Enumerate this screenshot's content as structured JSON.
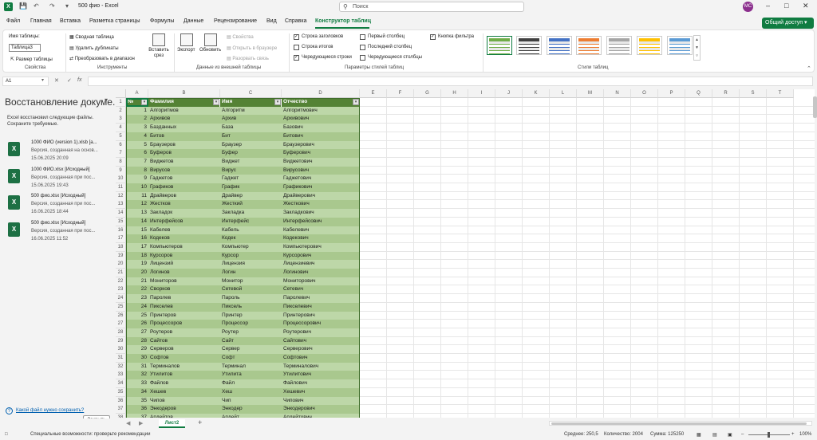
{
  "window": {
    "app_logo": "X",
    "title": "500 фио  -  Excel",
    "search_placeholder": "Поиск",
    "avatar": "MC"
  },
  "menu": {
    "items": [
      "Файл",
      "Главная",
      "Вставка",
      "Разметка страницы",
      "Формулы",
      "Данные",
      "Рецензирование",
      "Вид",
      "Справка",
      "Конструктор таблиц"
    ],
    "active": "Конструктор таблиц",
    "share": "Общий доступ"
  },
  "ribbon": {
    "table_name_label": "Имя таблицы:",
    "table_name_value": "Таблица3",
    "resize": "Размер таблицы",
    "group_props": "Свойства",
    "pivot": "Сводная таблица",
    "remove_dupes": "Удалить дубликаты",
    "convert": "Преобразовать в диапазон",
    "slicer": "Вставить срез",
    "group_tools": "Инструменты",
    "export": "Экспорт",
    "refresh": "Обновить",
    "properties": "Свойства",
    "open_browser": "Открыть в браузере",
    "unlink": "Разорвать связь",
    "group_external": "Данные из внешней таблицы",
    "opt_header": "Строка заголовков",
    "opt_total": "Строка итогов",
    "opt_banded_rows": "Чередующиеся строки",
    "opt_first_col": "Первый столбец",
    "opt_last_col": "Последний столбец",
    "opt_banded_cols": "Чередующиеся столбцы",
    "opt_filter": "Кнопка фильтра",
    "group_options": "Параметры стилей таблиц",
    "group_styles": "Стили таблиц",
    "style_colors": [
      "#70ad47",
      "#404040",
      "#4472c4",
      "#ed7d31",
      "#a5a5a5",
      "#ffc000",
      "#5b9bd5",
      "#8e3c8e"
    ]
  },
  "formula": {
    "cell": "A1",
    "fx": "fx",
    "value": ""
  },
  "recovery": {
    "title": "Восстановление докуме...",
    "desc": "Excel восстановил следующие файлы. Сохраните требуемые.",
    "files": [
      {
        "name": "1000 ФИО (version 1).xlsb  [а...",
        "version": "Версия, созданная на основ...",
        "date": "15.06.2025 20:09"
      },
      {
        "name": "1000 ФИО.xlsx  [Исходный]",
        "version": "Версия, созданная при пос...",
        "date": "15.06.2025 19:43"
      },
      {
        "name": "500 фио.xlsx  [Исходный]",
        "version": "Версия, созданная при пос...",
        "date": "16.06.2025 18:44"
      },
      {
        "name": "500 фио.xlsx  [Исходный]",
        "version": "Версия, созданная при пос...",
        "date": "16.06.2025 11:52"
      }
    ],
    "question": "Какой файл нужно сохранить?",
    "close": "Закрыть"
  },
  "grid": {
    "columns": [
      "A",
      "B",
      "C",
      "D",
      "E",
      "F",
      "G",
      "H",
      "I",
      "J",
      "K",
      "L",
      "M",
      "N",
      "O",
      "P",
      "Q",
      "R",
      "S",
      "T"
    ],
    "headers": [
      "№",
      "Фамилия",
      "Имя",
      "Отчество"
    ],
    "rows": [
      [
        1,
        "Алгоритмов",
        "Алгоритм",
        "Алгоритмович"
      ],
      [
        2,
        "Архивов",
        "Архив",
        "Архивович"
      ],
      [
        3,
        "Базданных",
        "База",
        "Базович"
      ],
      [
        4,
        "Битов",
        "Бит",
        "Битович"
      ],
      [
        5,
        "Браузеров",
        "Браузер",
        "Браузерович"
      ],
      [
        6,
        "Буферов",
        "Буфер",
        "Буферович"
      ],
      [
        7,
        "Виджетов",
        "Виджет",
        "Виджетович"
      ],
      [
        8,
        "Вирусов",
        "Вирус",
        "Вирусович"
      ],
      [
        9,
        "Гаджетов",
        "Гаджет",
        "Гаджетович"
      ],
      [
        10,
        "Графиков",
        "График",
        "Графикович"
      ],
      [
        11,
        "Драйверов",
        "Драйвер",
        "Драйверович"
      ],
      [
        12,
        "Жестков",
        "Жесткий",
        "Жесткович"
      ],
      [
        13,
        "Закладок",
        "Закладка",
        "Закладкович"
      ],
      [
        14,
        "Интерфейсов",
        "Интерфейс",
        "Интерфейсович"
      ],
      [
        15,
        "Кабелев",
        "Кабель",
        "Кабелевич"
      ],
      [
        16,
        "Кодеков",
        "Кодек",
        "Кодекович"
      ],
      [
        17,
        "Компьютеров",
        "Компьютер",
        "Компьютерович"
      ],
      [
        18,
        "Курсоров",
        "Курсор",
        "Курсорович"
      ],
      [
        19,
        "Лицензий",
        "Лицензия",
        "Лицензиевич"
      ],
      [
        20,
        "Логинов",
        "Логин",
        "Логинович"
      ],
      [
        21,
        "Мониторов",
        "Монитор",
        "Мониторович"
      ],
      [
        22,
        "Сворков",
        "Сетевой",
        "Сетевич"
      ],
      [
        23,
        "Паролев",
        "Пароль",
        "Паролевич"
      ],
      [
        24,
        "Пикселев",
        "Пиксель",
        "Пикселевич"
      ],
      [
        25,
        "Принтеров",
        "Принтер",
        "Принтерович"
      ],
      [
        26,
        "Процессоров",
        "Процессор",
        "Процессорович"
      ],
      [
        27,
        "Роутеров",
        "Роутер",
        "Роутерович"
      ],
      [
        28,
        "Сайтов",
        "Сайт",
        "Сайтович"
      ],
      [
        29,
        "Серверов",
        "Сервер",
        "Серверович"
      ],
      [
        30,
        "Софтов",
        "Софт",
        "Софтович"
      ],
      [
        31,
        "Терминалов",
        "Терминал",
        "Терминалович"
      ],
      [
        32,
        "Утилитов",
        "Утилита",
        "Утилитович"
      ],
      [
        33,
        "Файлов",
        "Файл",
        "Файлович"
      ],
      [
        34,
        "Хешев",
        "Хеш",
        "Хешевич"
      ],
      [
        35,
        "Чипов",
        "Чип",
        "Чипович"
      ],
      [
        36,
        "Энкодеров",
        "Энкодер",
        "Энкодерович"
      ],
      [
        37,
        "Апдейтов",
        "Апдейт",
        "Апдейтович"
      ]
    ],
    "row_numbers": [
      1,
      2,
      3,
      4,
      5,
      6,
      7,
      8,
      9,
      10,
      11,
      12,
      13,
      14,
      15,
      16,
      17,
      18,
      19,
      20,
      21,
      22,
      23,
      24,
      25,
      26,
      27,
      28,
      29,
      30,
      31,
      32,
      33,
      34,
      35,
      36,
      37,
      38
    ],
    "band_color_a": "#bdd7a8",
    "band_color_b": "#a9c88e",
    "header_color": "#548235"
  },
  "sheets": {
    "active": "Лист2",
    "add": "+"
  },
  "status": {
    "accessibility": "Специальные возможности: проверьте рекомендации",
    "avg": "Среднее: 250,5",
    "count": "Количество: 2004",
    "sum": "Сумма: 125250",
    "zoom": "100%"
  }
}
